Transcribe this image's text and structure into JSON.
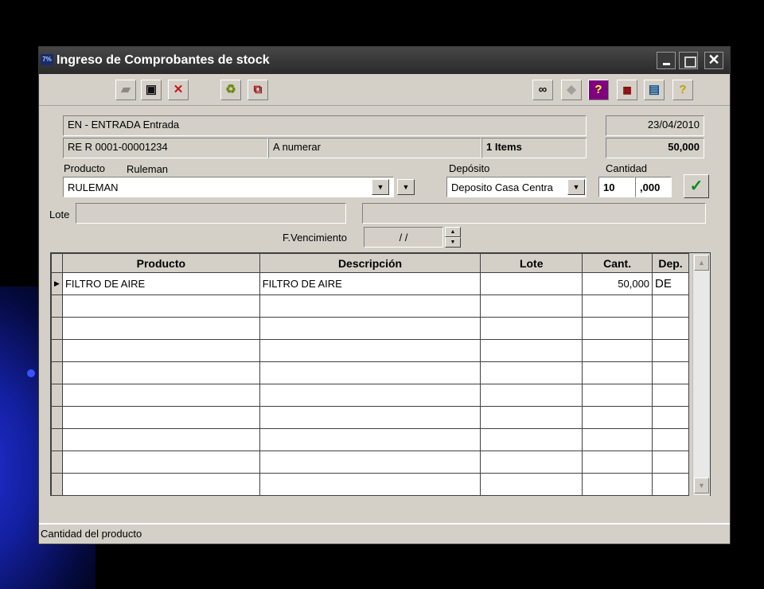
{
  "window": {
    "title": "Ingreso de Comprobantes de stock"
  },
  "toolbar": {
    "left_icons": [
      "eraser-icon",
      "save-icon",
      "delete-icon",
      "recycle-icon",
      "copy-icon"
    ],
    "right_icons": [
      "search-binoculars-icon",
      "tag-icon",
      "help-question-icon",
      "calculator-grid-icon",
      "calculator-icon",
      "help-icon"
    ]
  },
  "header": {
    "tipo": "EN - ENTRADA Entrada",
    "fecha": "23/04/2010",
    "comprobante": "RE R 0001-00001234",
    "numeracion": "A numerar",
    "items": "1 Items",
    "total": "50,000"
  },
  "form": {
    "producto_label": "Producto",
    "producto_desc": "Ruleman",
    "producto_value": "RULEMAN",
    "deposito_label": "Depósito",
    "deposito_value": "Deposito Casa Centra",
    "cantidad_label": "Cantidad",
    "cantidad_int": "10",
    "cantidad_dec": ",000",
    "lote_label": "Lote",
    "lote_value": "",
    "lote_desc": "",
    "vencimiento_label": "F.Vencimiento",
    "vencimiento_value": "/ /"
  },
  "grid": {
    "columns": [
      "Producto",
      "Descripción",
      "Lote",
      "Cant.",
      "Dep."
    ],
    "rows": [
      [
        "FILTRO DE AIRE",
        "FILTRO DE AIRE",
        "",
        "50,000",
        "DE"
      ],
      [
        "",
        "",
        "",
        "",
        ""
      ],
      [
        "",
        "",
        "",
        "",
        ""
      ],
      [
        "",
        "",
        "",
        "",
        ""
      ],
      [
        "",
        "",
        "",
        "",
        ""
      ],
      [
        "",
        "",
        "",
        "",
        ""
      ],
      [
        "",
        "",
        "",
        "",
        ""
      ],
      [
        "",
        "",
        "",
        "",
        ""
      ],
      [
        "",
        "",
        "",
        "",
        ""
      ],
      [
        "",
        "",
        "",
        "",
        ""
      ]
    ]
  },
  "status": {
    "text": "Cantidad del producto"
  },
  "colors": {
    "title_bar": "#2f2f2f",
    "window_bg": "#d4d0c8",
    "backdrop": "#000000",
    "accent_glow": "#2330d8"
  }
}
